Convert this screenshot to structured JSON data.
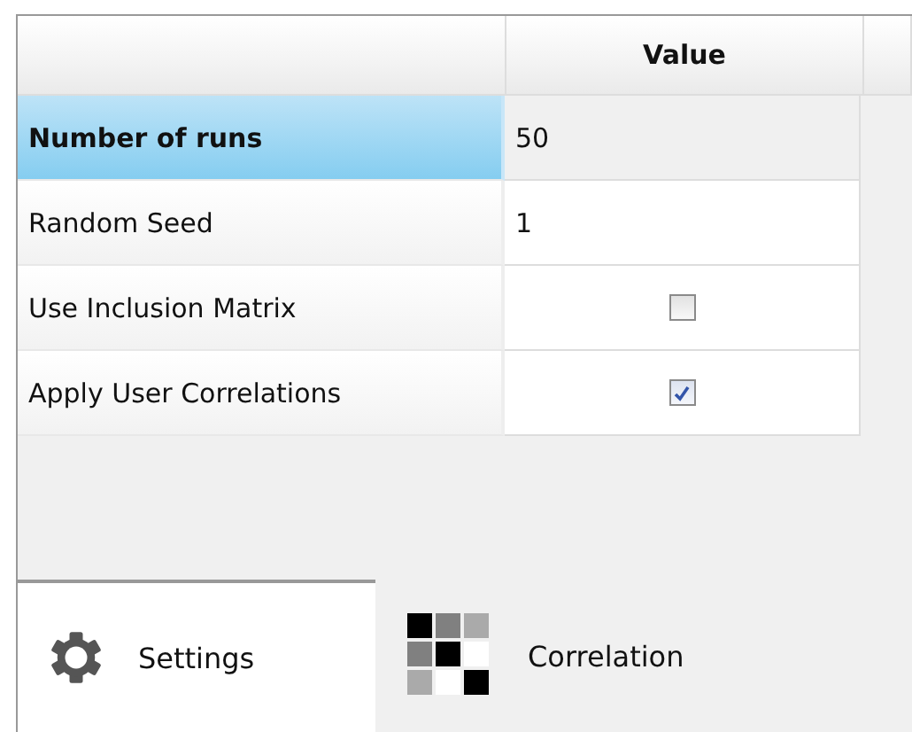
{
  "table": {
    "columns": [
      {
        "kind": "blank"
      },
      {
        "kind": "text",
        "label": "Value"
      }
    ],
    "rows": [
      {
        "label": "Number of runs",
        "kind": "text",
        "value": "50",
        "selected": true
      },
      {
        "label": "Random Seed",
        "kind": "text",
        "value": "1",
        "selected": false
      },
      {
        "label": "Use Inclusion Matrix",
        "kind": "checkbox",
        "checked": false,
        "selected": false
      },
      {
        "label": "Apply User Correlations",
        "kind": "checkbox",
        "checked": true,
        "selected": false
      }
    ]
  },
  "tabs": [
    {
      "label": "Settings",
      "selected": true
    },
    {
      "label": "Correlation",
      "selected": false
    }
  ]
}
